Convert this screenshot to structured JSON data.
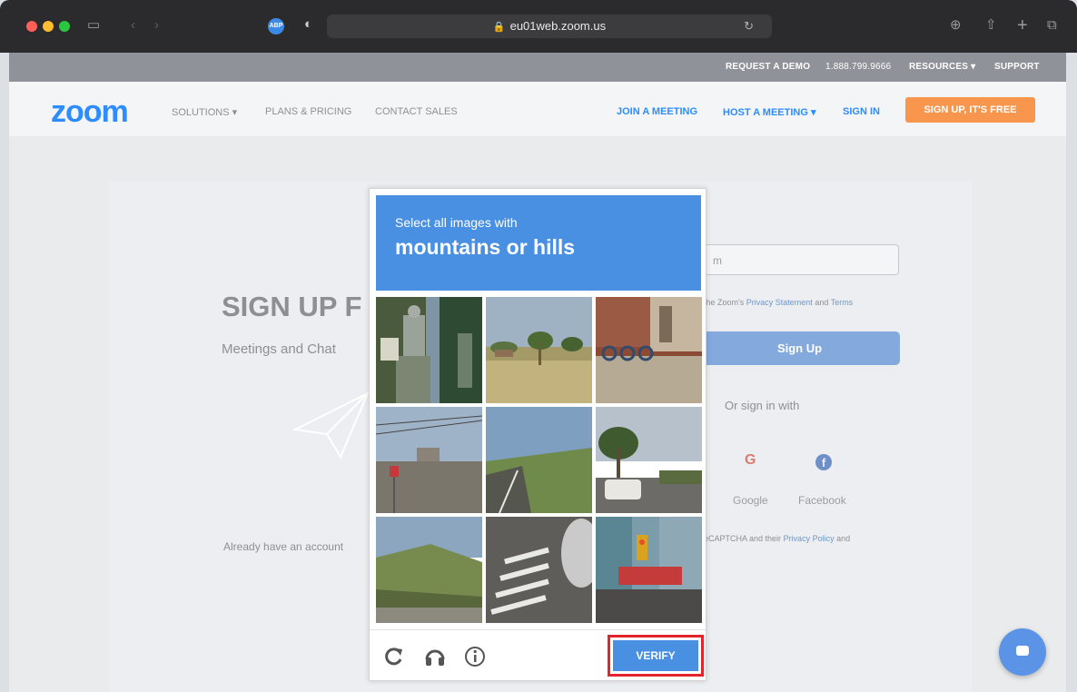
{
  "browser": {
    "url": "eu01web.zoom.us",
    "icons": [
      "sidebar-icon",
      "back-icon",
      "forward-icon",
      "adblock-icon",
      "shield-icon",
      "reload-icon",
      "download-icon",
      "share-icon",
      "new-tab-icon",
      "tab-overview-icon"
    ],
    "abp_label": "ABP"
  },
  "topstrip": {
    "request_demo": "REQUEST A DEMO",
    "phone": "1.888.799.9666",
    "resources": "RESOURCES ▾",
    "support": "SUPPORT"
  },
  "nav": {
    "logo": "zoom",
    "solutions": "SOLUTIONS ▾",
    "plans": "PLANS & PRICING",
    "contact": "CONTACT SALES",
    "join": "JOIN A MEETING",
    "host": "HOST A MEETING ▾",
    "signin": "SIGN IN",
    "signup": "SIGN UP, IT'S FREE"
  },
  "background": {
    "title": "SIGN UP F",
    "subtitle": "Meetings and Chat",
    "already": "Already have an account",
    "email_partial": "m",
    "terms_prefix": "the Zoom's",
    "privacy": "Privacy Statement",
    "and": "and",
    "terms": "Terms",
    "signup_button": "Sign Up",
    "or_sign_in": "Or sign in with",
    "google_glyph": "G",
    "facebook_glyph": "f",
    "google": "Google",
    "facebook": "Facebook",
    "recaptcha_prefix": "eCAPTCHA and their",
    "privacy_policy": "Privacy Policy",
    "recaptcha_and": "and"
  },
  "captcha": {
    "instruction": "Select all images with",
    "target": "mountains or hills",
    "verify": "VERIFY",
    "tiles": [
      "statue",
      "palm-trees-road",
      "bikes-building",
      "road-signs",
      "grassy-hill-road",
      "palms-van-street",
      "green-hill",
      "crosswalk-car",
      "traffic-light-building"
    ]
  }
}
